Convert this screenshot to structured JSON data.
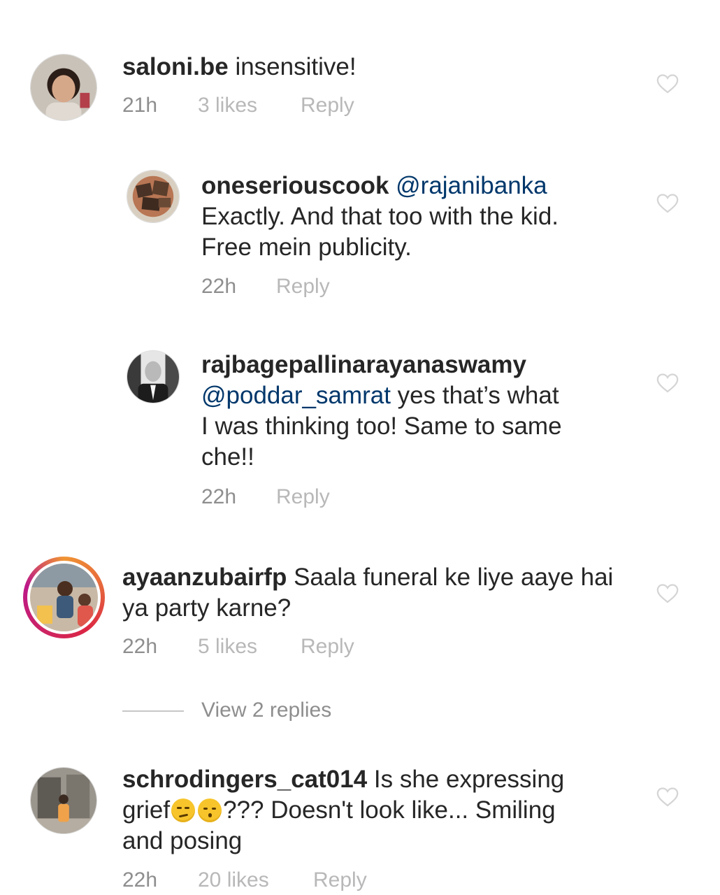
{
  "comments": [
    {
      "username": "saloni.be",
      "text": " insensitive!",
      "time": "21h",
      "likes": "3 likes",
      "reply": "Reply"
    },
    {
      "username": "oneseriouscook",
      "mention": "@rajanibanka",
      "text": "Exactly. And that too with the kid.\nFree mein publicity.",
      "time": "22h",
      "reply": "Reply"
    },
    {
      "username": "rajbagepallinarayanaswamy",
      "mention": "@poddar_samrat",
      "text": " yes that’s what\nI was thinking too! Same to same\nche!!",
      "time": "22h",
      "reply": "Reply"
    },
    {
      "username": "ayaanzubairfp",
      "text": " Saala funeral ke liye aaye hai\nya party karne?",
      "time": "22h",
      "likes": "5 likes",
      "reply": "Reply"
    },
    {
      "username": "schrodingers_cat014",
      "text_before": " Is she expressing\ngrief",
      "text_after": "??? Doesn't look like... Smiling\nand posing",
      "time": "22h",
      "likes": "20 likes",
      "reply": "Reply"
    }
  ],
  "view_replies": "View 2 replies",
  "icons": {
    "heart": "heart-outline-icon",
    "emoji_1": "smirking-face-emoji",
    "emoji_2": "kissing-face-emoji"
  },
  "colors": {
    "mention": "#00376b",
    "meta": "#8e8e8e",
    "story_ring": "#dc2743"
  }
}
